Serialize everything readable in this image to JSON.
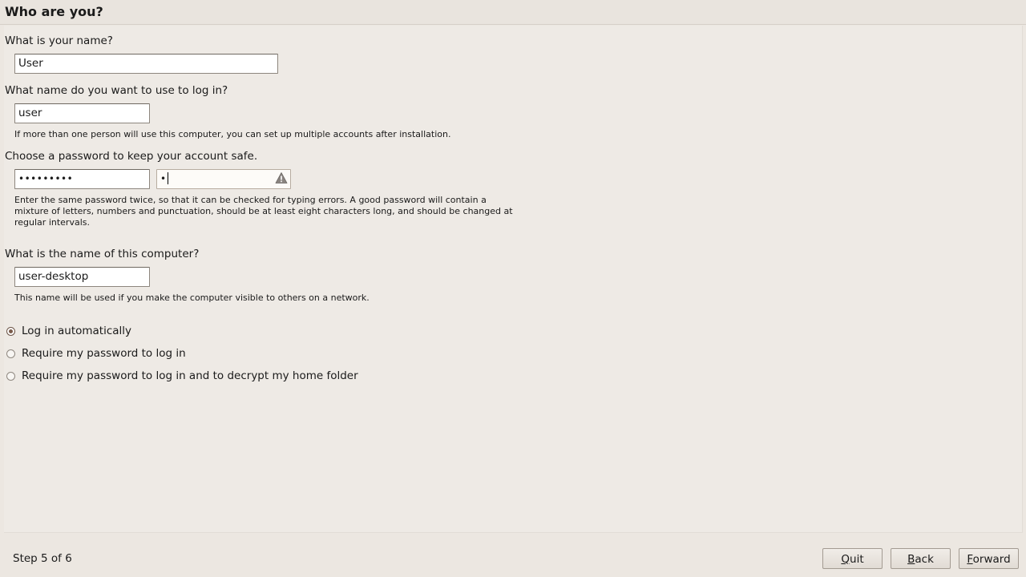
{
  "header": {
    "title": "Who are you?"
  },
  "name": {
    "question": "What is your name?",
    "value": "User"
  },
  "login": {
    "question": "What name do you want to use to log in?",
    "value": "user",
    "note": "If more than one person will use this computer, you can set up multiple accounts after installation."
  },
  "password": {
    "question": "Choose a password to keep your account safe.",
    "value_masked": "•••••••••",
    "confirm_masked": "•",
    "note_lines": [
      "Enter the same password twice, so that it can be checked for typing errors. A good password will contain a",
      "mixture of letters, numbers and punctuation, should be at least eight characters long, and should be changed at",
      "regular intervals."
    ],
    "warning_icon": "warning-triangle-icon"
  },
  "computer": {
    "question": "What is the name of this computer?",
    "value": "user-desktop",
    "note": "This name will be used if you make the computer visible to others on a network."
  },
  "login_options": [
    {
      "label": "Log in automatically",
      "checked": true
    },
    {
      "label": "Require my password to log in",
      "checked": false
    },
    {
      "label": "Require my password to log in and to decrypt my home folder",
      "checked": false
    }
  ],
  "footer": {
    "step": "Step 5 of 6",
    "buttons": {
      "quit": {
        "mnemonic": "Q",
        "rest": "uit"
      },
      "back": {
        "mnemonic": "B",
        "rest": "ack"
      },
      "forward": {
        "mnemonic": "F",
        "rest": "orward"
      }
    }
  }
}
